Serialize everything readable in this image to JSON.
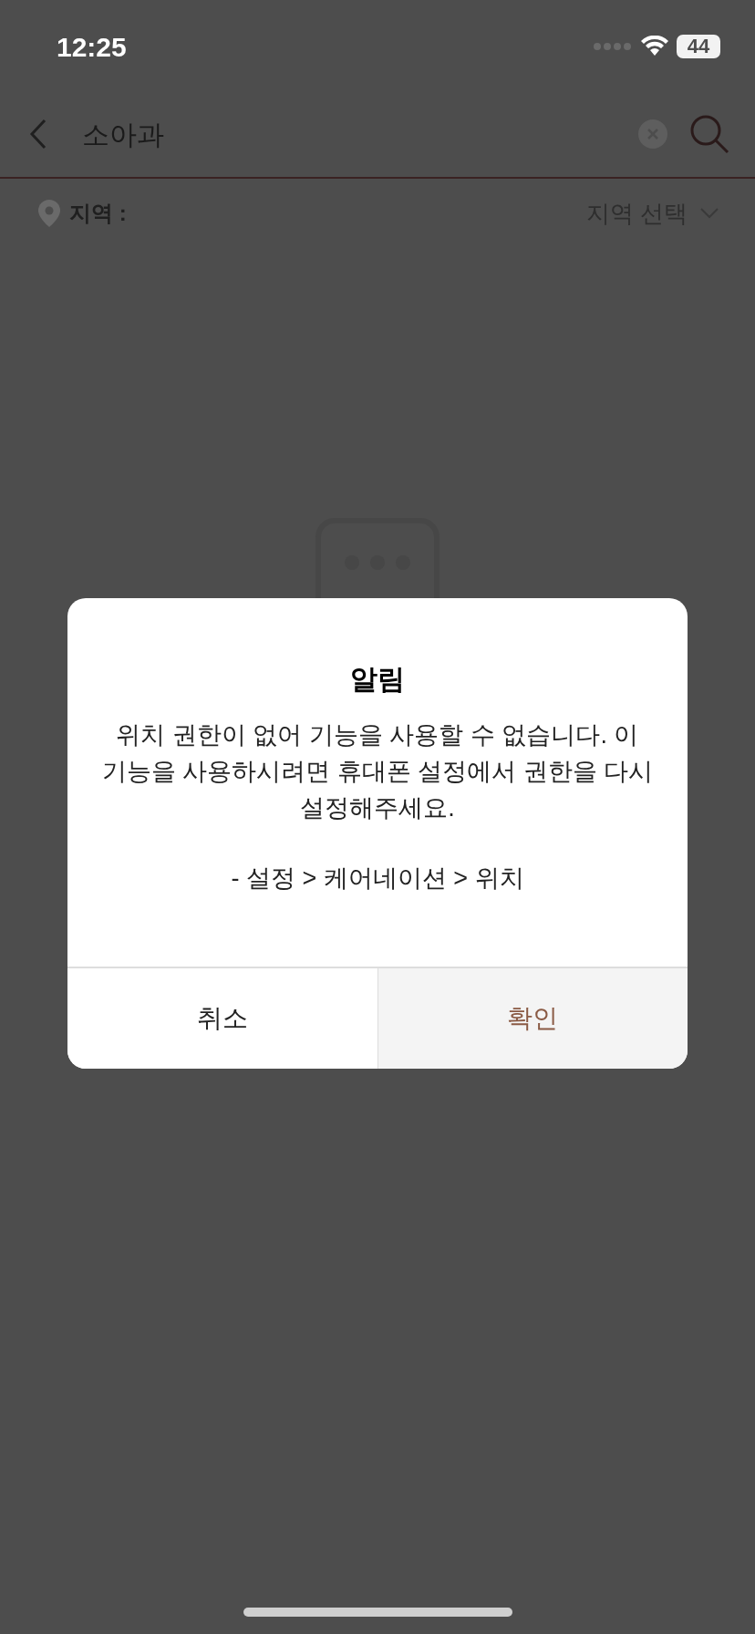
{
  "status_bar": {
    "time": "12:25",
    "battery": "44"
  },
  "header": {
    "search_value": "소아과"
  },
  "region": {
    "label": "지역 :",
    "select_placeholder": "지역 선택"
  },
  "dialog": {
    "title": "알림",
    "message": "위치 권한이 없어 기능을 사용할 수 없습니다. 이 기능을 사용하시려면 휴대폰 설정에서 권한을 다시 설정해주세요.",
    "path": "- 설정 > 케어네이션 > 위치",
    "buttons": [
      {
        "label": "취소",
        "kind": "cancel"
      },
      {
        "label": "확인",
        "kind": "confirm"
      }
    ]
  }
}
